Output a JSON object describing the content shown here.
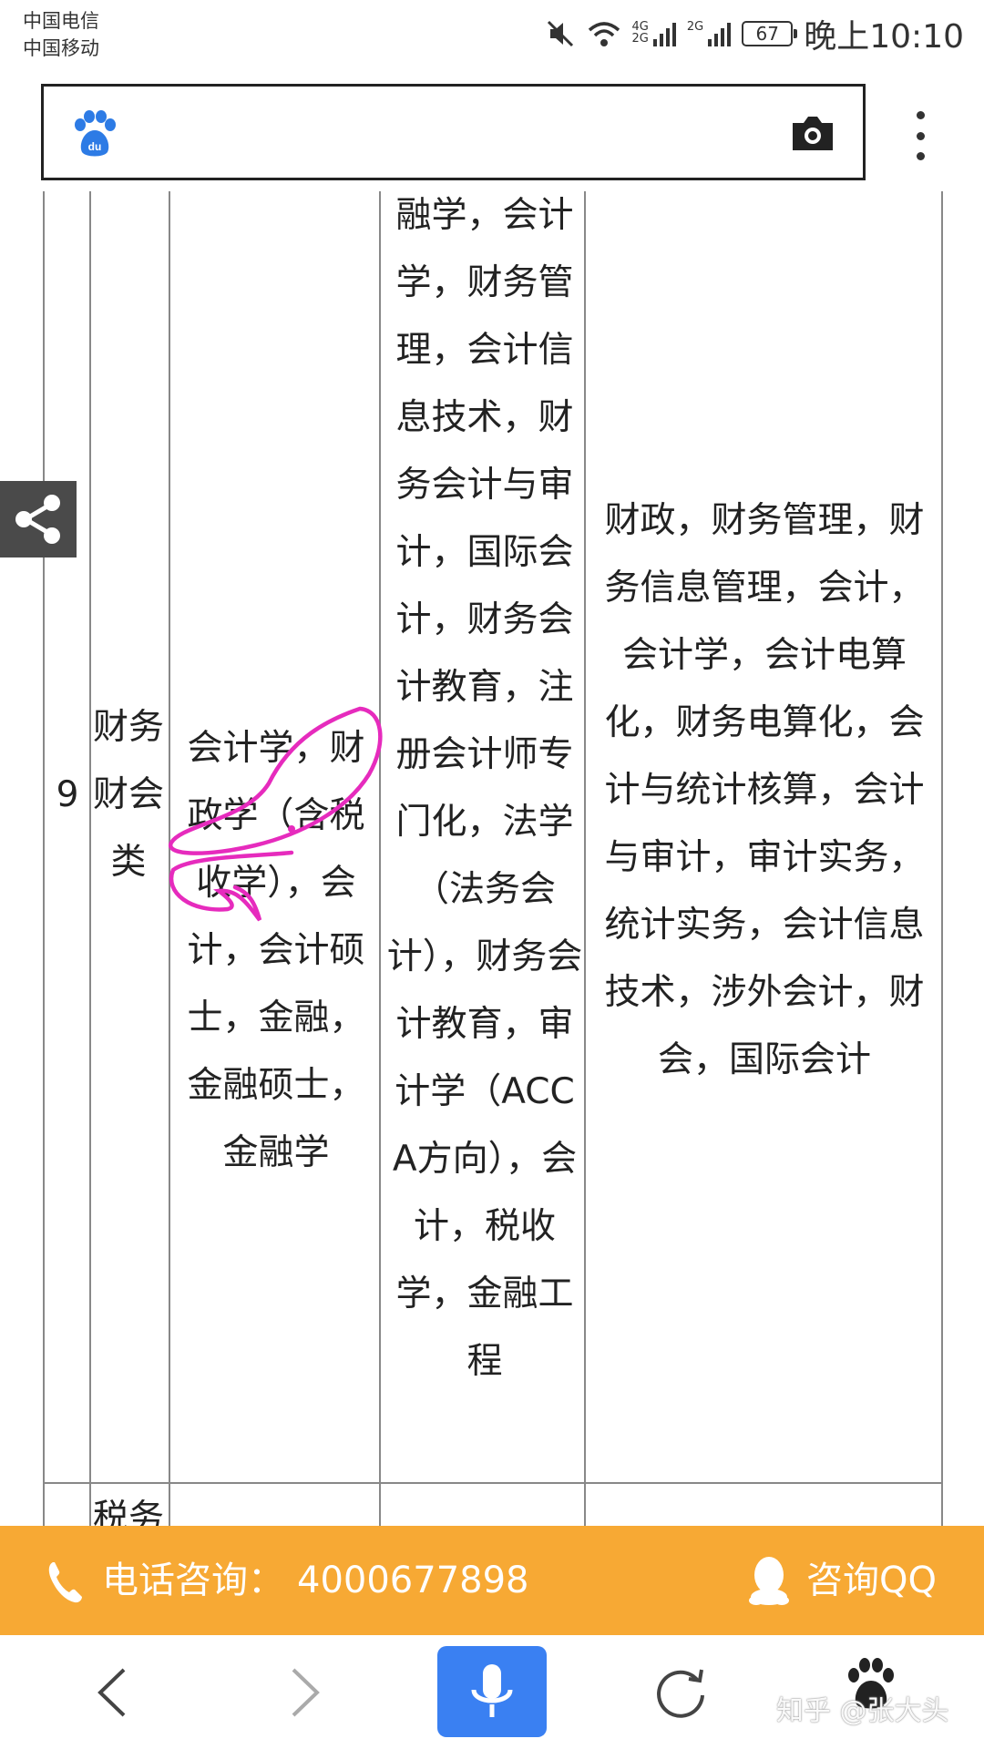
{
  "status_bar": {
    "carrier1": "中国电信",
    "carrier2": "中国移动",
    "net1_label": "4G",
    "net2_label": "2G",
    "net3_label": "2G",
    "battery": "67",
    "time": "晚上10:10"
  },
  "table": {
    "row_number": "9",
    "category": "财务财会类",
    "major_col1": "会计学，财政学（含税收学），会计，会计硕士，金融，金融硕士，金融学",
    "major_col2": "融学，会计学，财务管理，会计信息技术，财务会计与审计，国际会计，财务会计教育，注册会计师专门化，法学（法务会计），财务会计教育，审计学（ACCA方向），会计，税收学，金融工程",
    "major_col3": "财政，财务管理，财务信息管理，会计，会计学，会计电算化，财务电算化，会计与统计核算，会计与审计，审计实务，统计实务，会计信息技术，涉外会计，财会，国际会计",
    "next_category": "税务"
  },
  "consult_bar": {
    "phone_label": "电话咨询：",
    "phone_number": "4000677898",
    "qq_label": "咨询QQ"
  },
  "watermark": "知乎 @张大头",
  "colors": {
    "consult_bg": "#f7a934",
    "mic_bg": "#3a80f2",
    "baidu_blue": "#2d7be5",
    "annotation": "#e62bbd"
  },
  "icons": [
    "baidu-logo",
    "camera-icon",
    "more-menu-icon",
    "share-icon",
    "phone-icon",
    "qq-icon",
    "back-icon",
    "forward-icon",
    "mic-icon",
    "refresh-icon",
    "baidu-paw-icon"
  ]
}
